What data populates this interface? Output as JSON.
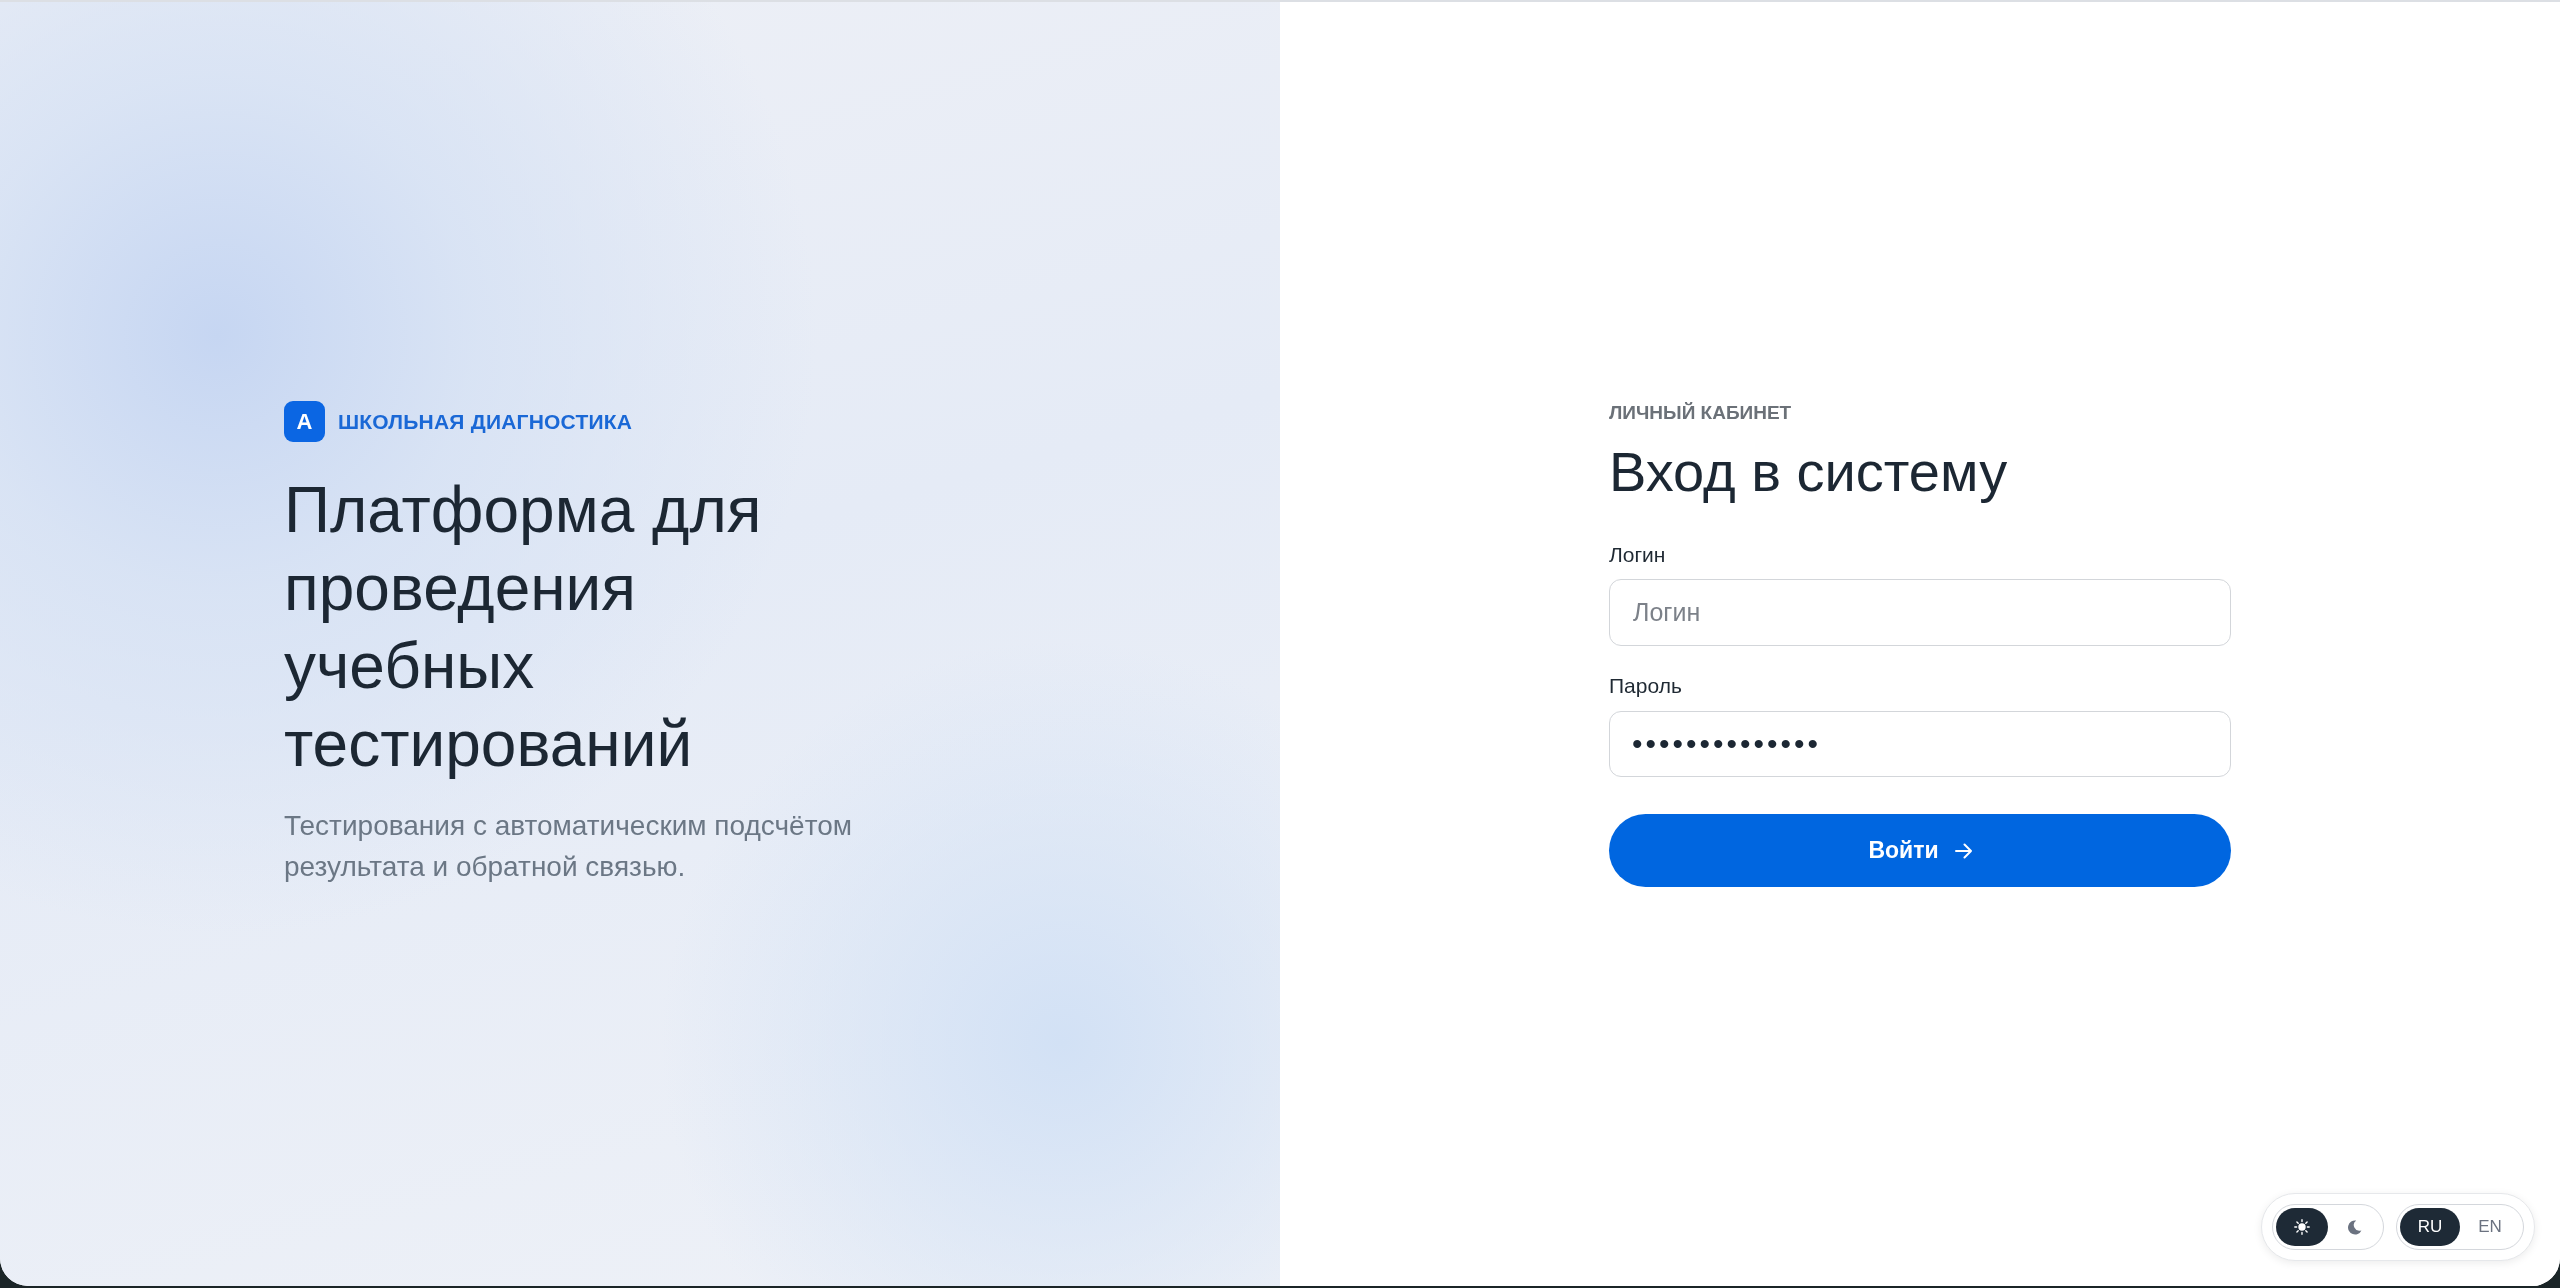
{
  "brand": {
    "logo_letter": "A",
    "name": "ШКОЛЬНАЯ ДИАГНОСТИКА"
  },
  "hero": {
    "title": "Платформа для проведения учебных тестирований",
    "subtitle": "Тестирования с автоматическим подсчётом результата и обратной связью."
  },
  "login_form": {
    "eyebrow": "ЛИЧНЫЙ КАБИНЕТ",
    "title": "Вход в систему",
    "fields": [
      {
        "kind": "text",
        "label": "Логин",
        "placeholder": "Логин"
      },
      {
        "kind": "password",
        "label": "Пароль",
        "value": "••••••••••••••"
      }
    ],
    "submit": {
      "label": "Войти"
    }
  },
  "theme_toggle": [
    {
      "kind": "light",
      "selected": true
    },
    {
      "kind": "dark",
      "selected": false
    }
  ],
  "language_toggle": [
    {
      "label": "RU",
      "selected": true
    },
    {
      "label": "EN",
      "selected": false
    }
  ]
}
